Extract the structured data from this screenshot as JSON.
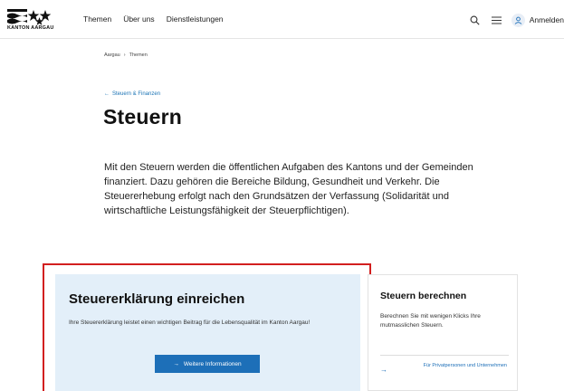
{
  "header": {
    "logo_text": "KANTON AARGAU",
    "nav": [
      "Themen",
      "Über uns",
      "Dienstleistungen"
    ],
    "login_label": "Anmelden"
  },
  "breadcrumb": [
    "Aargau",
    "Themen"
  ],
  "back_link": "Steuern & Finanzen",
  "title": "Steuern",
  "intro": "Mit den Steuern werden die öffentlichen Aufgaben des Kantons und der Gemeinden finanziert. Dazu gehören die Bereiche Bildung, Gesundheit und Verkehr. Die Steuererhebung erfolgt nach den Grundsätzen der Verfassung (Solidarität und wirtschaftliche Leistungsfähigkeit der Steuerpflichtigen).",
  "card_primary": {
    "title": "Steuererklärung einreichen",
    "description": "Ihre Steuererklärung leistet einen wichtigen Beitrag für die Lebensqualität im Kanton Aargau!",
    "button_label": "Weitere Informationen"
  },
  "card_secondary": {
    "title": "Steuern berechnen",
    "description": "Berechnen Sie mit wenigen Klicks Ihre mutmasslichen Steuern.",
    "link_label": "Für Privatpersonen und Unternehmen"
  },
  "colors": {
    "accent": "#1d6fb8",
    "highlight": "#d21f1f",
    "card_bg": "#e3eff9"
  },
  "icons": [
    "search-icon",
    "menu-icon",
    "user-icon",
    "arrow-left-icon",
    "arrow-right-icon"
  ]
}
